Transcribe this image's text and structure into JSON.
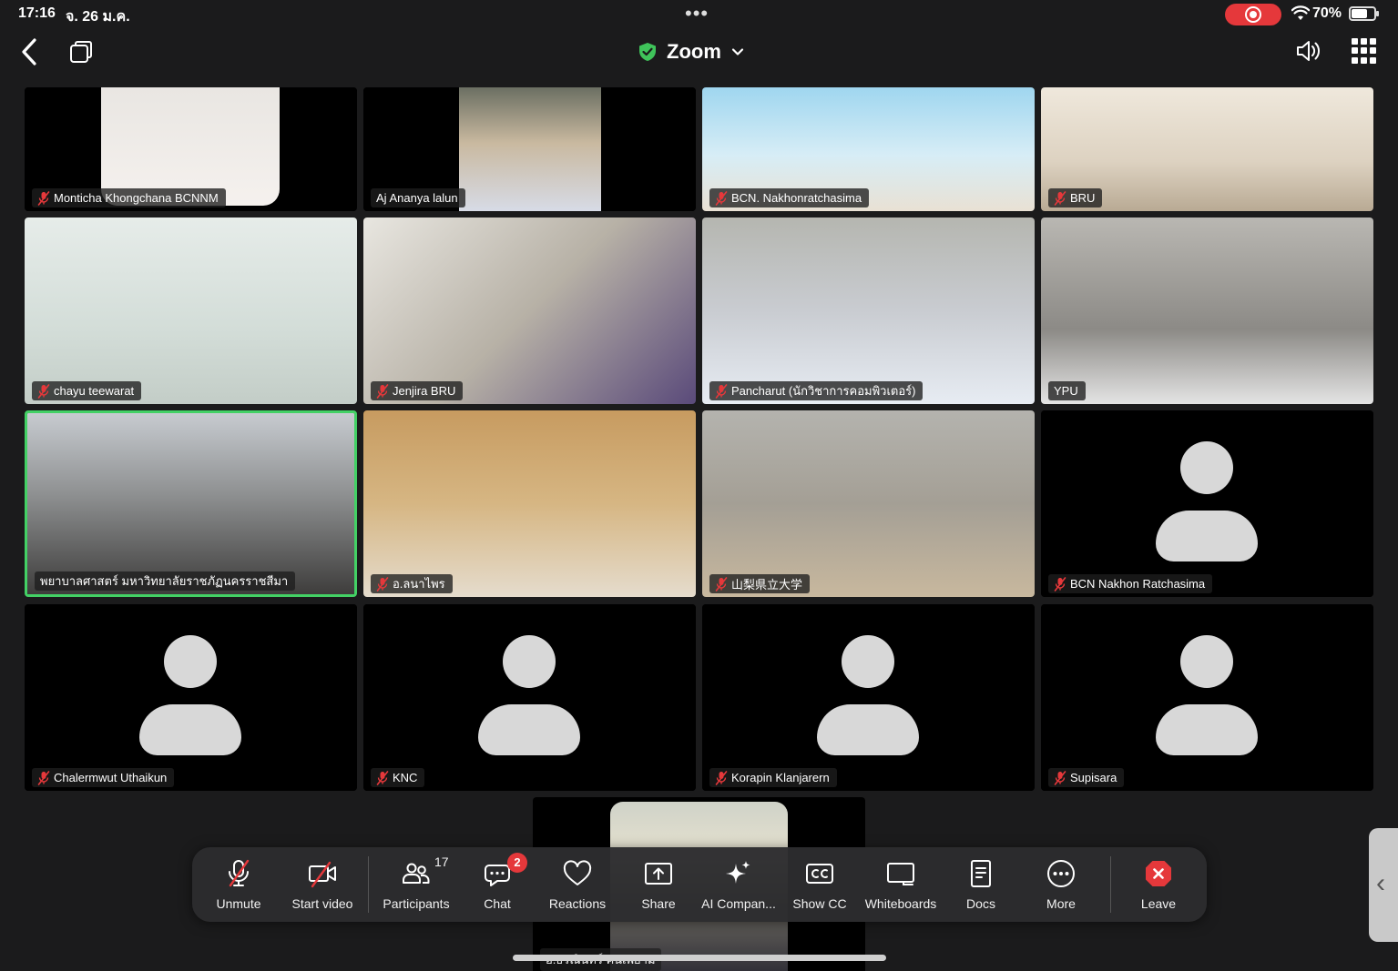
{
  "status": {
    "time": "17:16",
    "date": "จ. 26 ม.ค.",
    "battery": "70%",
    "battery_level": 0.7
  },
  "header": {
    "title": "Zoom"
  },
  "tiles": [
    {
      "name": "Monticha Khongchana BCNNM",
      "muted": true,
      "video": "photo"
    },
    {
      "name": "Aj Ananya lalun",
      "muted": false,
      "video": "photo"
    },
    {
      "name": "BCN. Nakhonratchasima",
      "muted": true,
      "video": "photo"
    },
    {
      "name": "BRU",
      "muted": true,
      "video": "photo"
    },
    {
      "name": "chayu teewarat",
      "muted": true,
      "video": "photo"
    },
    {
      "name": "Jenjira BRU",
      "muted": true,
      "video": "photo"
    },
    {
      "name": "Pancharut (นักวิชาการคอมพิวเตอร์)",
      "muted": true,
      "video": "photo"
    },
    {
      "name": "YPU",
      "muted": false,
      "video": "photo"
    },
    {
      "name": "พยาบาลศาสตร์ มหาวิทยาลัยราชภัฏนครราชสีมา",
      "muted": false,
      "video": "photo",
      "active": true
    },
    {
      "name": "อ.ลนาไพร",
      "muted": true,
      "video": "photo"
    },
    {
      "name": "山梨県立大学",
      "muted": true,
      "video": "photo"
    },
    {
      "name": "BCN Nakhon Ratchasima",
      "muted": true,
      "video": "avatar"
    },
    {
      "name": "Chalermwut Uthaikun",
      "muted": true,
      "video": "avatar"
    },
    {
      "name": "KNC",
      "muted": true,
      "video": "avatar"
    },
    {
      "name": "Korapin Klanjarern",
      "muted": true,
      "video": "avatar"
    },
    {
      "name": "Supisara",
      "muted": true,
      "video": "avatar"
    }
  ],
  "self_view": {
    "label": "อ.ธรณินทร์ คนเพยาม"
  },
  "toolbar": {
    "unmute": "Unmute",
    "start_video": "Start video",
    "participants": "Participants",
    "participants_count": "17",
    "chat": "Chat",
    "chat_badge": "2",
    "reactions": "Reactions",
    "share": "Share",
    "ai_companion": "AI Compan...",
    "show_cc": "Show CC",
    "whiteboards": "Whiteboards",
    "docs": "Docs",
    "more": "More",
    "leave": "Leave"
  },
  "colors": {
    "active_border": "#43d165",
    "record": "#e5383b",
    "mute_red": "#e5383b",
    "leave_red": "#e5383b",
    "secure_green": "#3fc35a"
  }
}
